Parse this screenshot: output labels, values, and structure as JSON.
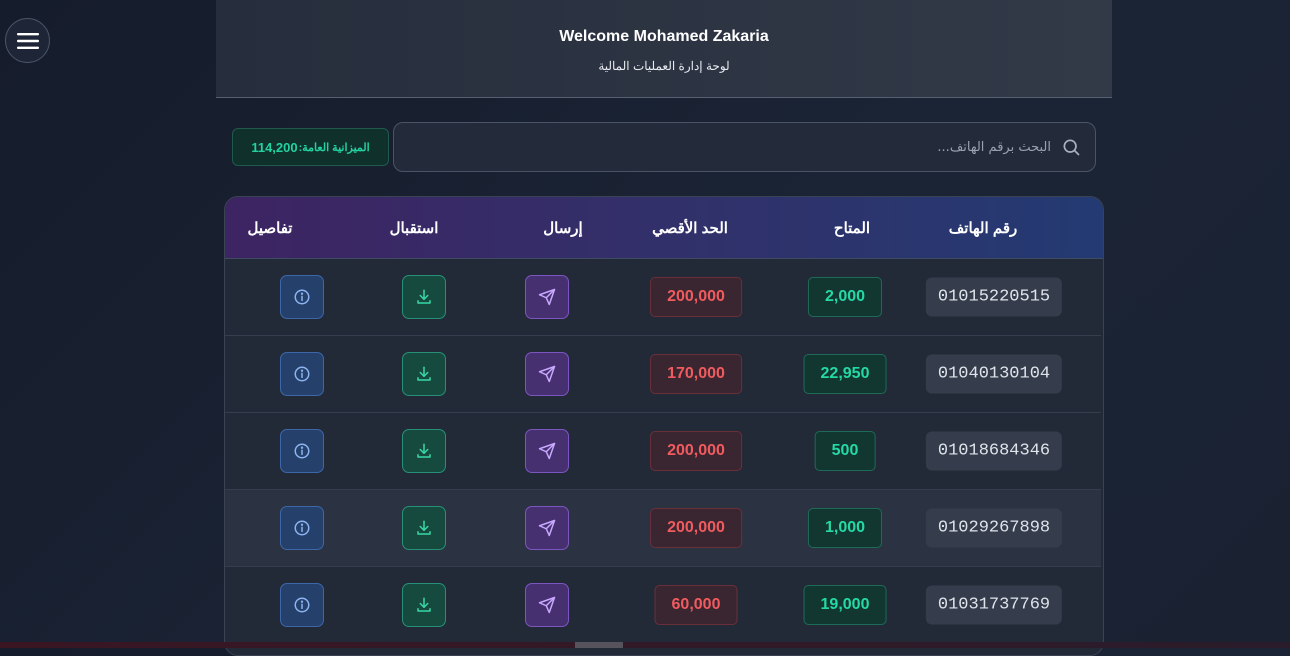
{
  "header": {
    "welcome": "Welcome Mohamed Zakaria",
    "subtitle": "لوحة إدارة العمليات المالية"
  },
  "budget": {
    "label": "الميزانية العامة:",
    "amount": "114,200"
  },
  "search": {
    "placeholder": "البحث برقم الهاتف..."
  },
  "table": {
    "columns": {
      "phone": "رقم الهاتف",
      "available": "المتاح",
      "limit": "الحد الأقصي",
      "send": "إرسال",
      "receive": "استقبال",
      "details": "تفاصيل"
    },
    "rows": [
      {
        "phone": "01015220515",
        "available": "2,000",
        "limit": "200,000"
      },
      {
        "phone": "01040130104",
        "available": "22,950",
        "limit": "170,000"
      },
      {
        "phone": "01018684346",
        "available": "500",
        "limit": "200,000"
      },
      {
        "phone": "01029267898",
        "available": "1,000",
        "limit": "200,000"
      },
      {
        "phone": "01031737769",
        "available": "19,000",
        "limit": "60,000"
      }
    ]
  },
  "icons": {
    "menu": "menu-icon",
    "search": "search-icon",
    "send": "send-icon",
    "receive": "download-icon",
    "details": "info-icon"
  },
  "colors": {
    "available": "#25d9a4",
    "limit": "#f05b5f",
    "send": "#c9a8ff",
    "receive": "#38d8a8",
    "details": "#8cb4f0"
  }
}
